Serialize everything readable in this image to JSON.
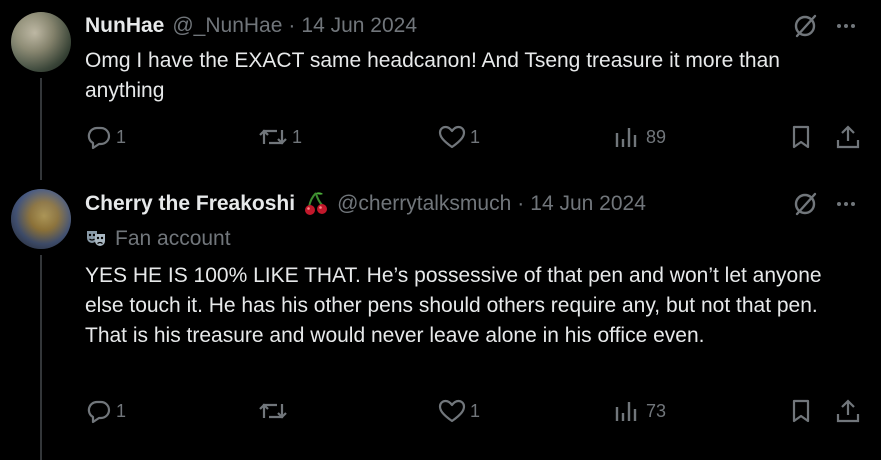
{
  "colors": {
    "background": "#000000",
    "text": "#e7e9ea",
    "muted": "#71767b",
    "thread_line": "#333639",
    "cherry": "#c2182b"
  },
  "tweets": [
    {
      "name": "NunHae",
      "handle": "@_NunHae",
      "separator": "·",
      "date": "14 Jun 2024",
      "text": "Omg I have the EXACT same headcanon! And Tseng treasure it more than anything",
      "icons": [
        "grok-icon",
        "more-icon"
      ],
      "reply_count": "1",
      "repost_count": "1",
      "like_count": "1",
      "view_count": "89"
    },
    {
      "name": "Cherry the Freakoshi",
      "name_emoji": "cherries-emoji",
      "handle": "@cherrytalksmuch",
      "separator": "·",
      "date": "14 Jun 2024",
      "badge": "Fan account",
      "badge_icon": "masks-emoji",
      "text": "YES HE IS 100% LIKE THAT. He’s possessive of that pen and won’t let anyone else touch it. He has his other pens should others require any, but not that pen. That is his treasure and would never leave alone in his office even.",
      "icons": [
        "grok-icon",
        "more-icon"
      ],
      "reply_count": "1",
      "repost_count": "",
      "like_count": "1",
      "view_count": "73"
    }
  ]
}
